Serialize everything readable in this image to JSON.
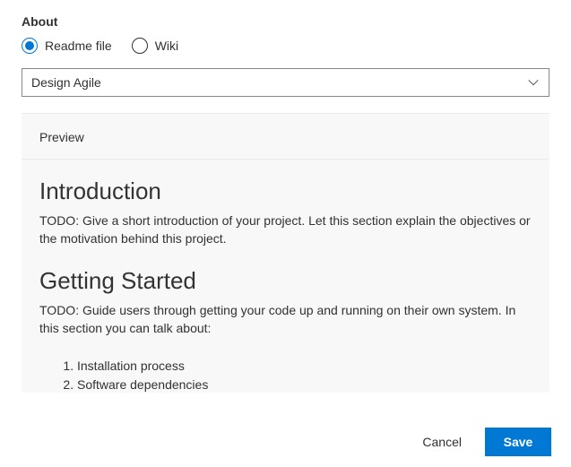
{
  "section_title": "About",
  "radios": {
    "readme_label": "Readme file",
    "wiki_label": "Wiki",
    "selected": "readme"
  },
  "dropdown": {
    "value": "Design Agile"
  },
  "tabs": {
    "preview_label": "Preview"
  },
  "preview": {
    "h1_intro": "Introduction",
    "p_intro": "TODO: Give a short introduction of your project. Let this section explain the objectives or the motivation behind this project.",
    "h1_getting_started": "Getting Started",
    "p_getting_started": "TODO: Guide users through getting your code up and running on their own system. In this section you can talk about:",
    "list": {
      "item1": "Installation process",
      "item2": "Software dependencies"
    }
  },
  "buttons": {
    "cancel": "Cancel",
    "save": "Save"
  }
}
